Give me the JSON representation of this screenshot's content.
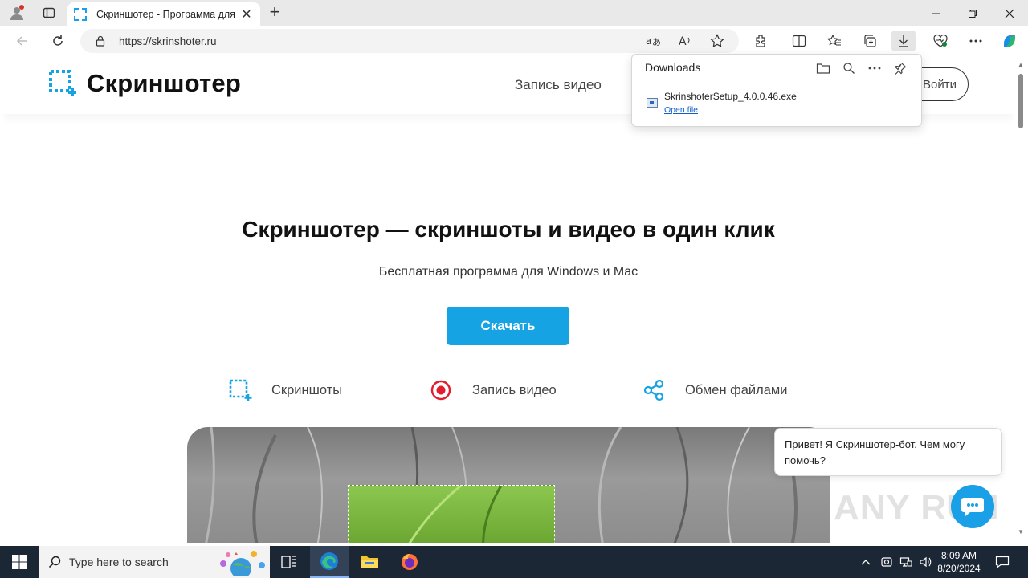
{
  "browser": {
    "tab_title": "Скриншотер - Программа для",
    "tab_close": "✕",
    "new_tab": "+",
    "url": "https://skrinshoter.ru"
  },
  "site": {
    "logo_text": "Скриншотер",
    "nav_link": "Запись видео",
    "login": "Войти",
    "hero_title": "Скриншотер — скриншоты и видео в один клик",
    "hero_subtitle": "Бесплатная программа для Windows и Mac",
    "download_button": "Скачать",
    "features": [
      {
        "label": "Скриншоты",
        "icon": "screenshot-icon"
      },
      {
        "label": "Запись видео",
        "icon": "record-icon"
      },
      {
        "label": "Обмен файлами",
        "icon": "share-icon"
      }
    ],
    "accent_color": "#15a3e4"
  },
  "downloads": {
    "title": "Downloads",
    "file_name": "SkrinshoterSetup_4.0.0.46.exe",
    "open_file": "Open file"
  },
  "chat": {
    "message": "Привет! Я Скриншотер-бот. Чем могу помочь?"
  },
  "watermark": "ANY RUN",
  "taskbar": {
    "search_placeholder": "Type here to search",
    "time": "8:09 AM",
    "date": "8/20/2024"
  }
}
